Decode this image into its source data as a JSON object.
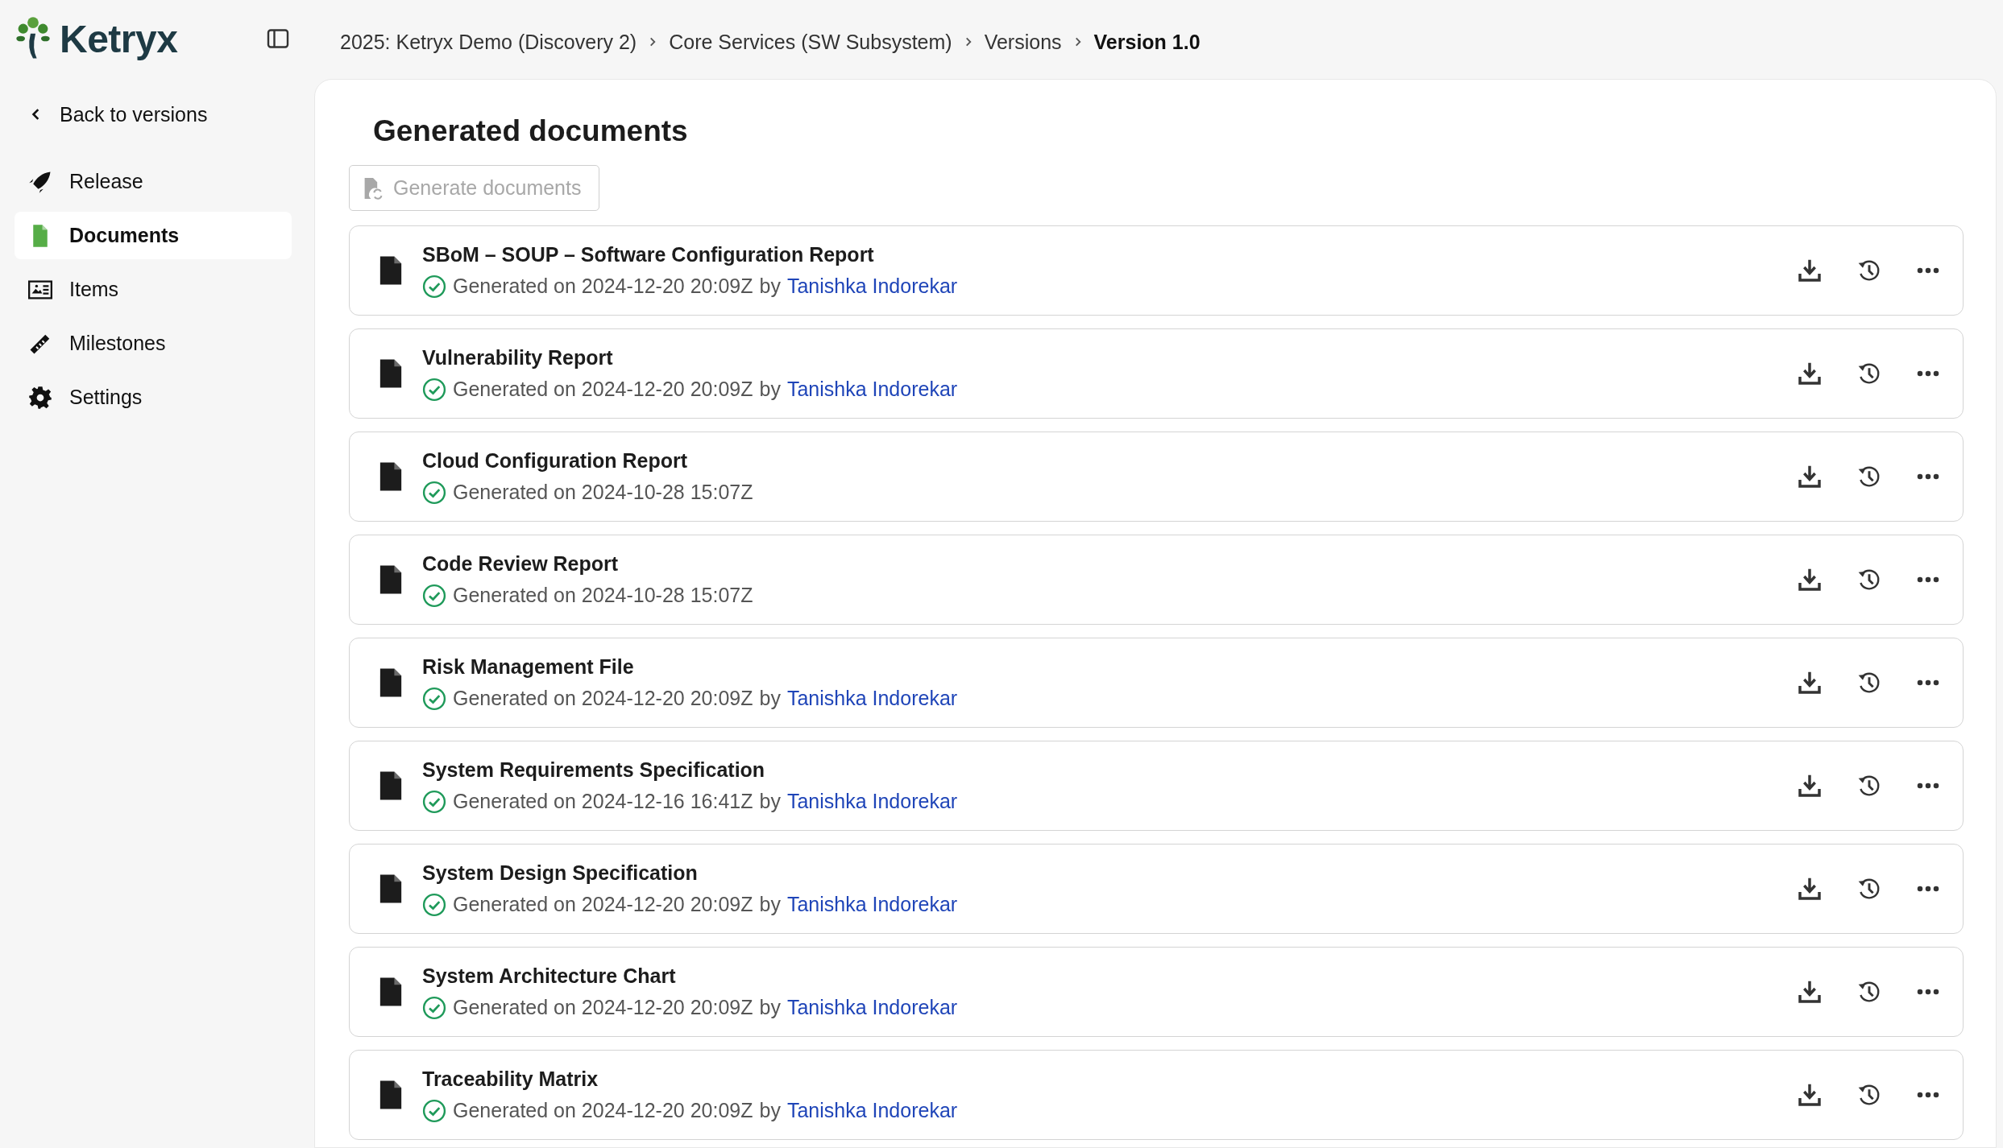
{
  "sidebar": {
    "brand": "Ketryx",
    "back_link": "Back to versions",
    "items": [
      {
        "label": "Release",
        "selected": false
      },
      {
        "label": "Documents",
        "selected": true
      },
      {
        "label": "Items",
        "selected": false
      },
      {
        "label": "Milestones",
        "selected": false
      },
      {
        "label": "Settings",
        "selected": false
      }
    ]
  },
  "breadcrumb": [
    {
      "label": "2025: Ketryx Demo (Discovery 2)",
      "current": false
    },
    {
      "label": "Core Services (SW Subsystem)",
      "current": false
    },
    {
      "label": "Versions",
      "current": false
    },
    {
      "label": "Version 1.0",
      "current": true
    }
  ],
  "page_title": "Generated documents",
  "generate_button": {
    "label": "Generate documents",
    "disabled": true
  },
  "documents": [
    {
      "title": "SBoM – SOUP – Software Configuration Report",
      "status": "Generated on 2024-12-20 20:09Z",
      "by": "by",
      "author": "Tanishka Indorekar"
    },
    {
      "title": "Vulnerability Report",
      "status": "Generated on 2024-12-20 20:09Z",
      "by": "by",
      "author": "Tanishka Indorekar"
    },
    {
      "title": "Cloud Configuration Report",
      "status": "Generated on 2024-10-28 15:07Z"
    },
    {
      "title": "Code Review Report",
      "status": "Generated on 2024-10-28 15:07Z"
    },
    {
      "title": "Risk Management File",
      "status": "Generated on 2024-12-20 20:09Z",
      "by": "by",
      "author": "Tanishka Indorekar"
    },
    {
      "title": "System Requirements Specification",
      "status": "Generated on 2024-12-16 16:41Z",
      "by": "by",
      "author": "Tanishka Indorekar"
    },
    {
      "title": "System Design Specification",
      "status": "Generated on 2024-12-20 20:09Z",
      "by": "by",
      "author": "Tanishka Indorekar"
    },
    {
      "title": "System Architecture Chart",
      "status": "Generated on 2024-12-20 20:09Z",
      "by": "by",
      "author": "Tanishka Indorekar"
    },
    {
      "title": "Traceability Matrix",
      "status": "Generated on 2024-12-20 20:09Z",
      "by": "by",
      "author": "Tanishka Indorekar"
    }
  ]
}
